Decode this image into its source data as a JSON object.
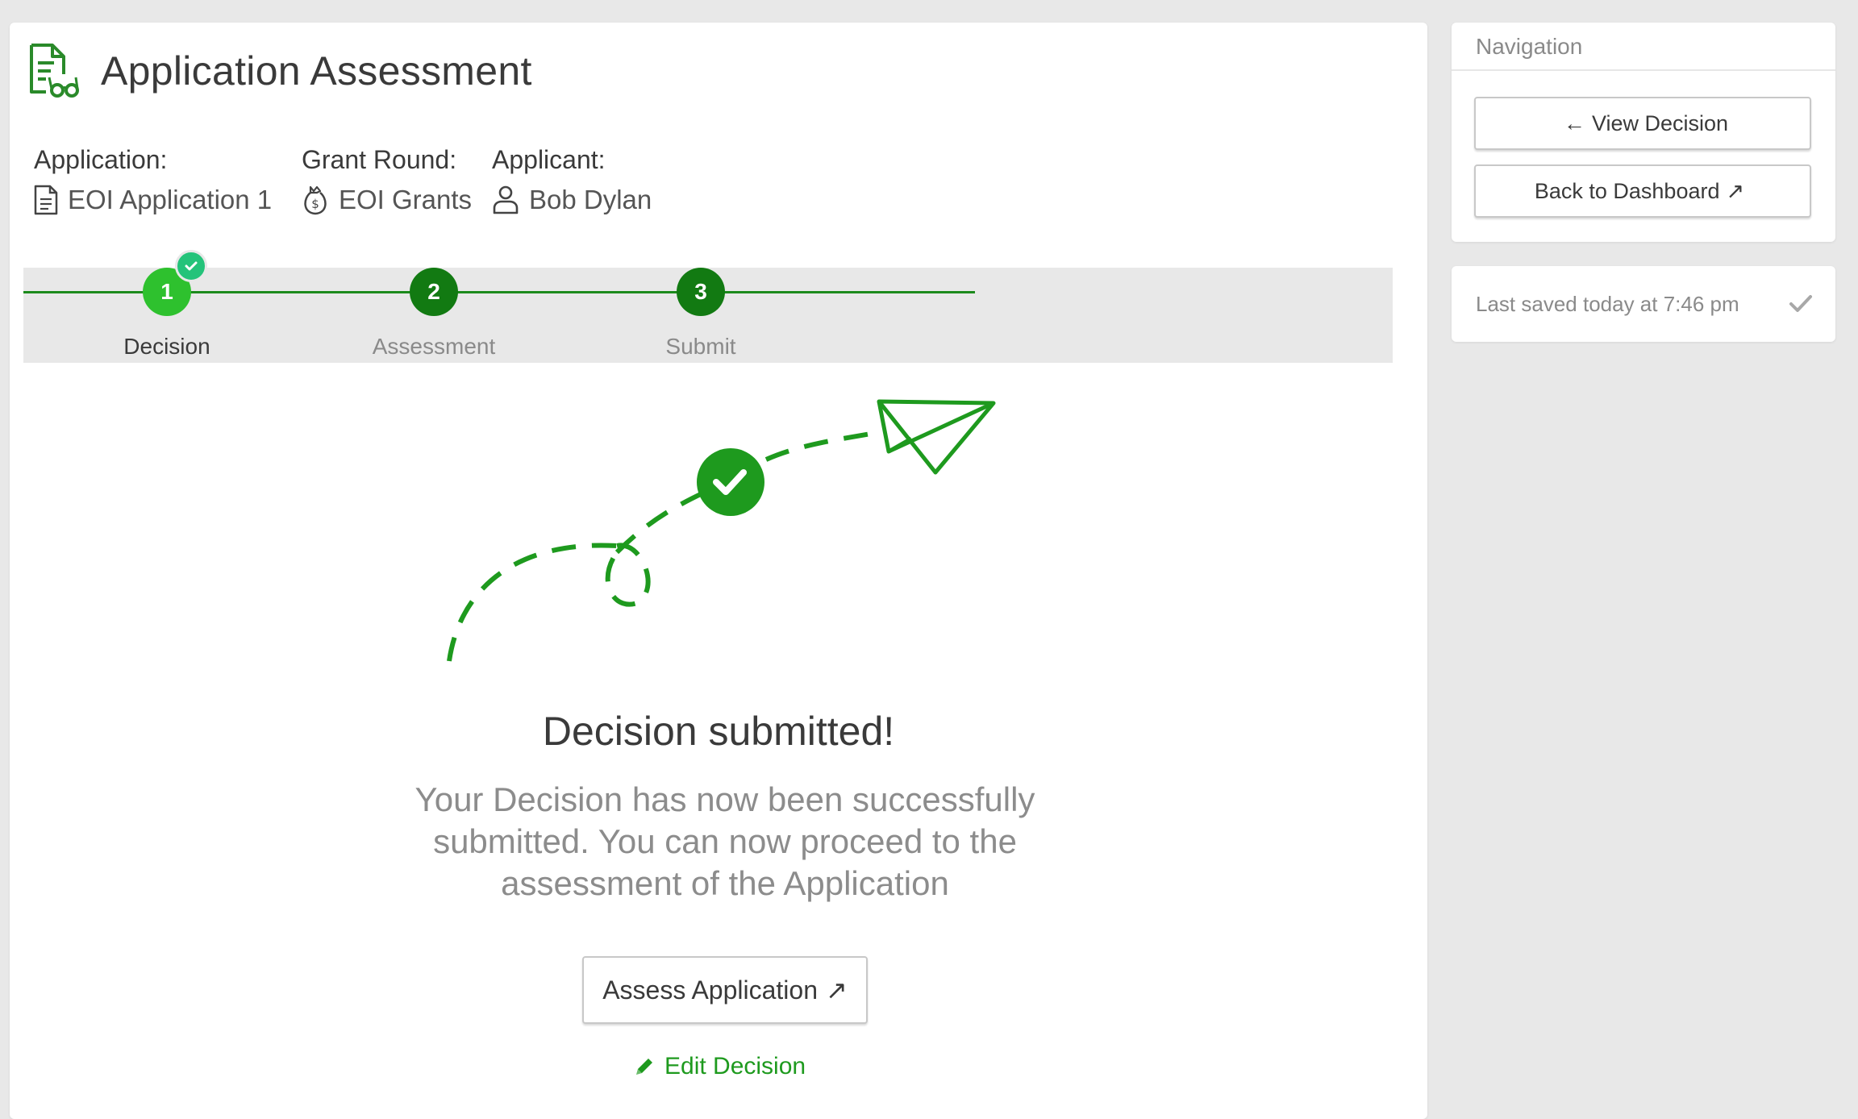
{
  "header": {
    "title": "Application Assessment",
    "icon": "application-document-glasses-icon"
  },
  "meta": {
    "application": {
      "label": "Application:",
      "value": "EOI Application 1",
      "icon": "document-icon"
    },
    "grant_round": {
      "label": "Grant Round:",
      "value": "EOI Grants",
      "icon": "money-bag-icon"
    },
    "applicant": {
      "label": "Applicant:",
      "value": "Bob Dylan",
      "icon": "user-icon"
    }
  },
  "stepper": {
    "steps": [
      {
        "number": "1",
        "label": "Decision",
        "state": "completed-current"
      },
      {
        "number": "2",
        "label": "Assessment",
        "state": "upcoming"
      },
      {
        "number": "3",
        "label": "Submit",
        "state": "upcoming"
      }
    ]
  },
  "success": {
    "title": "Decision submitted!",
    "message": "Your Decision has now been successfully submitted. You can now proceed to the assessment of the Application",
    "assess_button": "Assess Application",
    "assess_arrow": "↗",
    "edit_link": "Edit Decision"
  },
  "navigation": {
    "title": "Navigation",
    "view_decision": "View Decision",
    "view_decision_arrow": "←",
    "back_to_dashboard": "Back to Dashboard",
    "back_to_dashboard_arrow": "↗"
  },
  "save_status": {
    "text": "Last saved today at 7:46 pm",
    "icon": "checkmark-icon"
  },
  "colors": {
    "accent_green": "#1e9a1e",
    "step_done": "#2ec12e",
    "step_todo": "#127a12",
    "badge": "#24c37a"
  }
}
